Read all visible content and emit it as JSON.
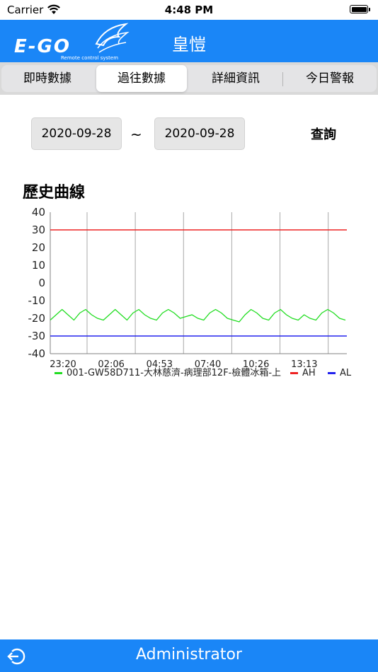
{
  "status_bar": {
    "carrier": "Carrier",
    "time": "4:48 PM",
    "battery_percent": 100
  },
  "header": {
    "title": "皇愷",
    "logo_text": "E-GO",
    "logo_subtitle": "Remote control system",
    "brand_color": "#1a86f7"
  },
  "tabs": [
    {
      "label": "即時數據",
      "selected": false
    },
    {
      "label": "過往數據",
      "selected": true
    },
    {
      "label": "詳細資訊",
      "selected": false
    },
    {
      "label": "今日警報",
      "selected": false
    }
  ],
  "query": {
    "start_date": "2020-09-28",
    "separator": "~",
    "end_date": "2020-09-28",
    "button_label": "查詢"
  },
  "chart_section_title": "歷史曲線",
  "chart_data": {
    "type": "line",
    "title": "",
    "xlabel": "",
    "ylabel": "",
    "ylim": [
      -40,
      40
    ],
    "y_ticks": [
      40,
      30,
      20,
      10,
      0,
      -10,
      -20,
      -30,
      -40
    ],
    "x_tick_labels": [
      "23:20",
      "02:06",
      "04:53",
      "07:40",
      "10:26",
      "13:13"
    ],
    "grid": "vertical",
    "legend_position": "bottom",
    "series": [
      {
        "name": "001-GW58D711-大林慈濟-病理部12F-檢體冰箱-上",
        "color": "#22dd22",
        "values": [
          -21,
          -18,
          -15,
          -18,
          -21,
          -17,
          -15,
          -18,
          -20,
          -21,
          -18,
          -15,
          -18,
          -21,
          -17,
          -15,
          -18,
          -20,
          -21,
          -17,
          -15,
          -17,
          -20,
          -19,
          -18,
          -20,
          -21,
          -17,
          -15,
          -17,
          -20,
          -21,
          -22,
          -18,
          -15,
          -17,
          -20,
          -21,
          -17,
          -15,
          -18,
          -20,
          -21,
          -18,
          -20,
          -21,
          -17,
          -15,
          -17,
          -20,
          -21
        ]
      },
      {
        "name": "AH",
        "color": "#ee2222",
        "constant": 30
      },
      {
        "name": "AL",
        "color": "#2222ee",
        "constant": -30
      }
    ]
  },
  "footer": {
    "user": "Administrator"
  }
}
